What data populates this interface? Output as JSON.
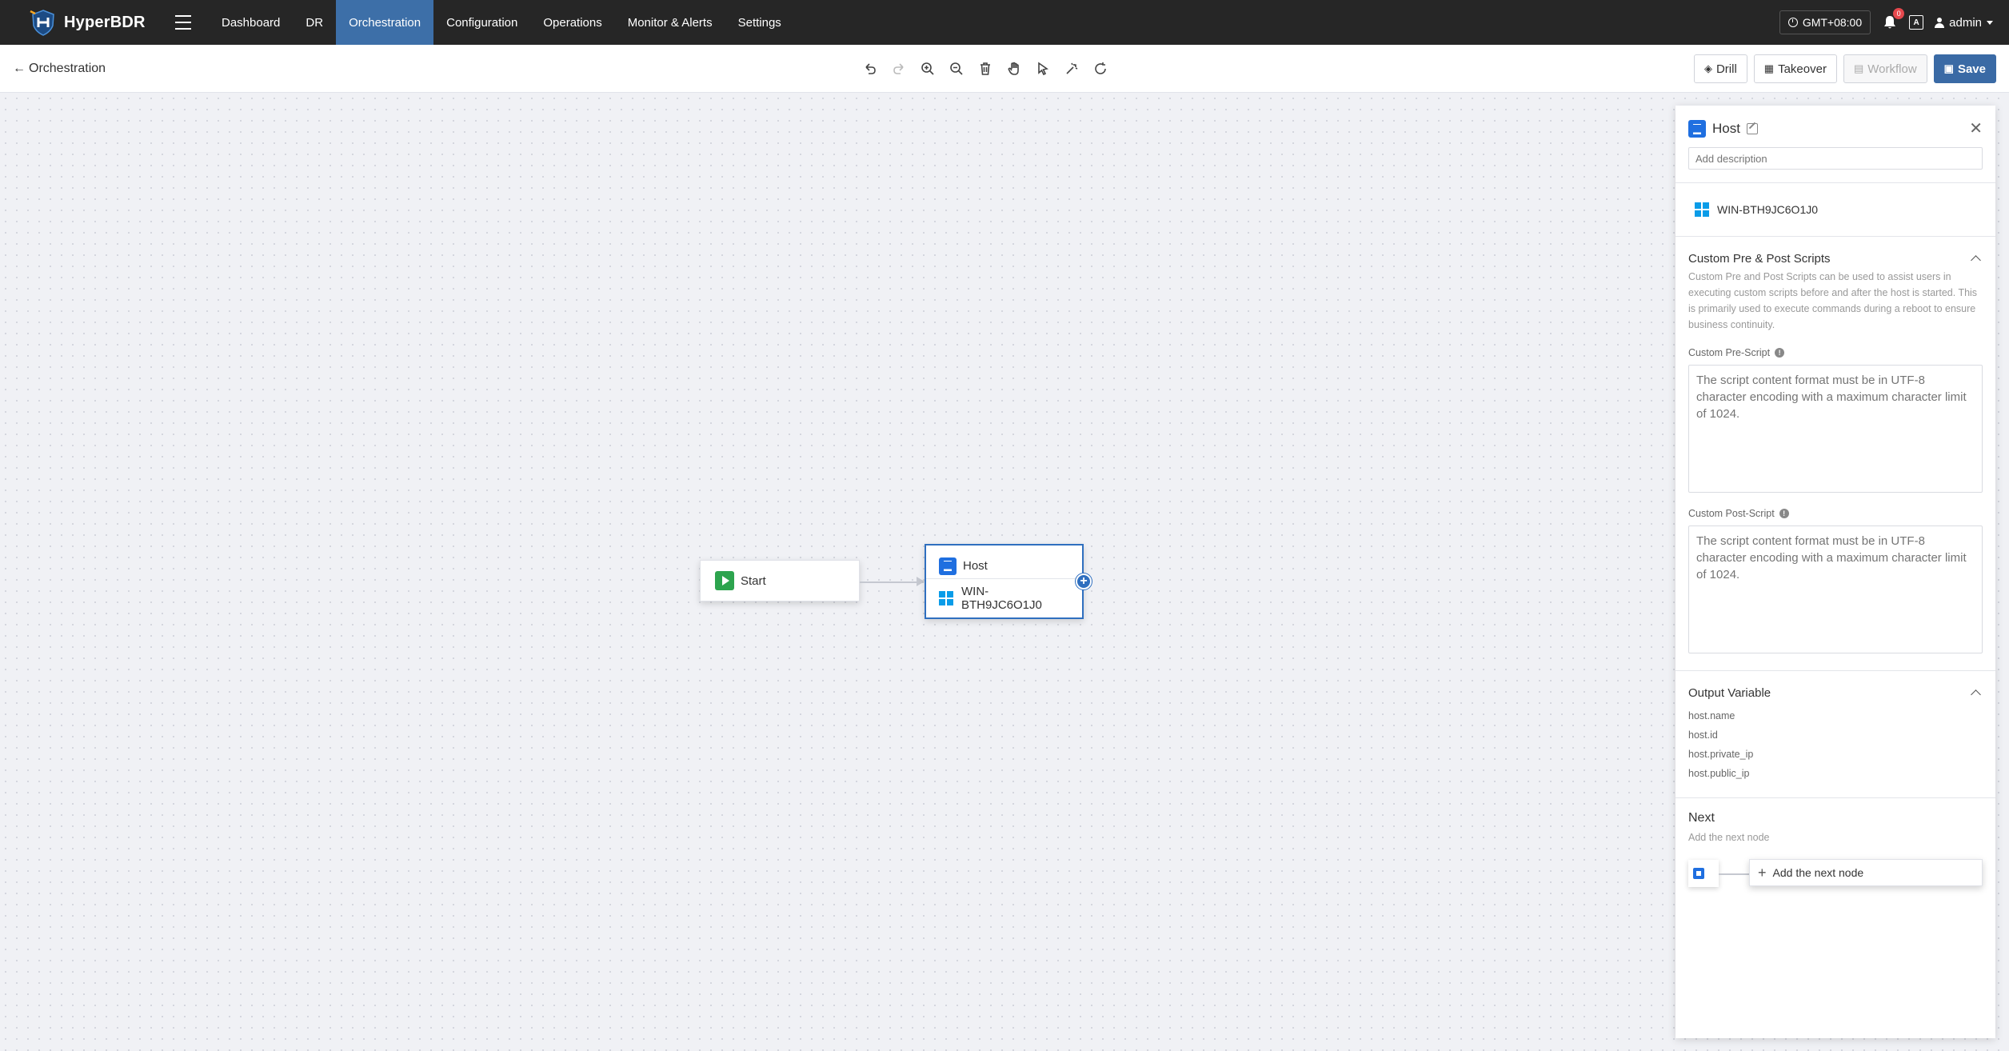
{
  "app": {
    "name": "HyperBDR"
  },
  "nav": {
    "items": [
      {
        "label": "Dashboard",
        "active": false
      },
      {
        "label": "DR",
        "active": false
      },
      {
        "label": "Orchestration",
        "active": true
      },
      {
        "label": "Configuration",
        "active": false
      },
      {
        "label": "Operations",
        "active": false
      },
      {
        "label": "Monitor & Alerts",
        "active": false
      },
      {
        "label": "Settings",
        "active": false
      }
    ],
    "timezone": "GMT+08:00",
    "notification_count": "0",
    "lang_icon": "A",
    "user": "admin"
  },
  "toolbar": {
    "back_label": "Orchestration",
    "tools": [
      "undo-icon",
      "redo-icon",
      "zoom-in-icon",
      "zoom-out-icon",
      "delete-icon",
      "pan-hand-icon",
      "select-pointer-icon",
      "auto-layout-icon",
      "refresh-icon"
    ],
    "drill_label": "Drill",
    "takeover_label": "Takeover",
    "workflow_label": "Workflow",
    "save_label": "Save"
  },
  "canvas": {
    "start_node": {
      "label": "Start"
    },
    "host_node": {
      "title": "Host",
      "host_name": "WIN-BTH9JC6O1J0"
    }
  },
  "panel": {
    "title": "Host",
    "description_placeholder": "Add description",
    "host_name": "WIN-BTH9JC6O1J0",
    "scripts": {
      "title": "Custom Pre & Post Scripts",
      "description": "Custom Pre and Post Scripts can be used to assist users in executing custom scripts before and after the host is started. This is primarily used to execute commands during a reboot to ensure business continuity.",
      "pre_label": "Custom Pre-Script",
      "pre_placeholder": "The script content format must be in UTF-8 character encoding with a maximum character limit of 1024.",
      "post_label": "Custom Post-Script",
      "post_placeholder": "The script content format must be in UTF-8 character encoding with a maximum character limit of 1024."
    },
    "output": {
      "title": "Output Variable",
      "variables": [
        "host.name",
        "host.id",
        "host.private_ip",
        "host.public_ip"
      ]
    },
    "next": {
      "title": "Next",
      "subtitle": "Add the next node",
      "add_label": "Add the next node"
    }
  },
  "colors": {
    "nav_bg": "#262626",
    "accent": "#3a6aa5",
    "host_blue": "#1f6fe0",
    "start_green": "#2da44e",
    "windows_blue": "#0a9ce8"
  }
}
